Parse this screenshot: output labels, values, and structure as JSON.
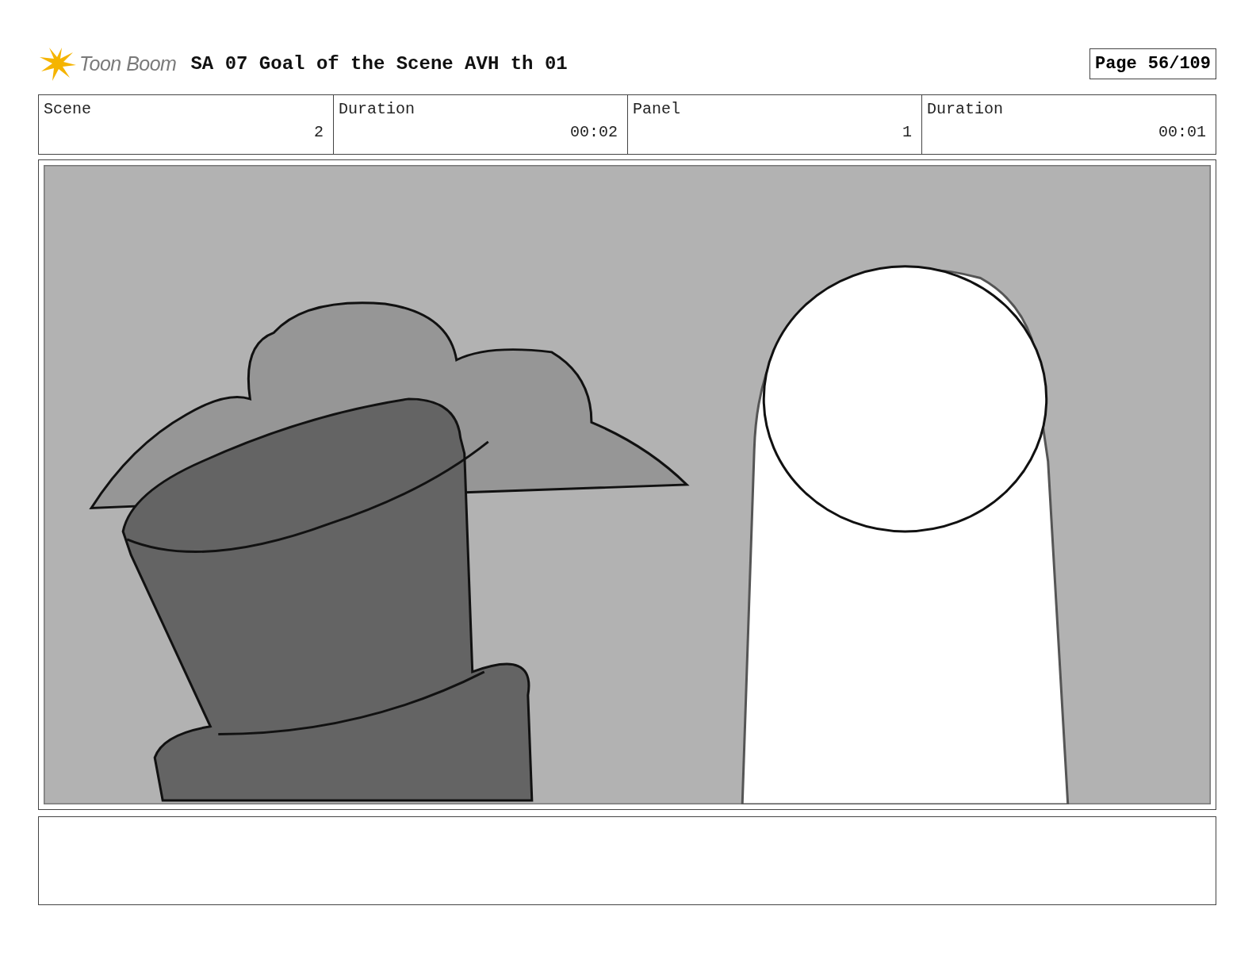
{
  "header": {
    "logo": "Toon Boom",
    "title": "SA 07 Goal of the Scene AVH th 01",
    "page_label": "Page",
    "page_number": "56/109"
  },
  "info": [
    {
      "label": "Scene",
      "value": "2"
    },
    {
      "label": "Duration",
      "value": "00:02"
    },
    {
      "label": "Panel",
      "value": "1"
    },
    {
      "label": "Duration",
      "value": "00:01"
    }
  ]
}
